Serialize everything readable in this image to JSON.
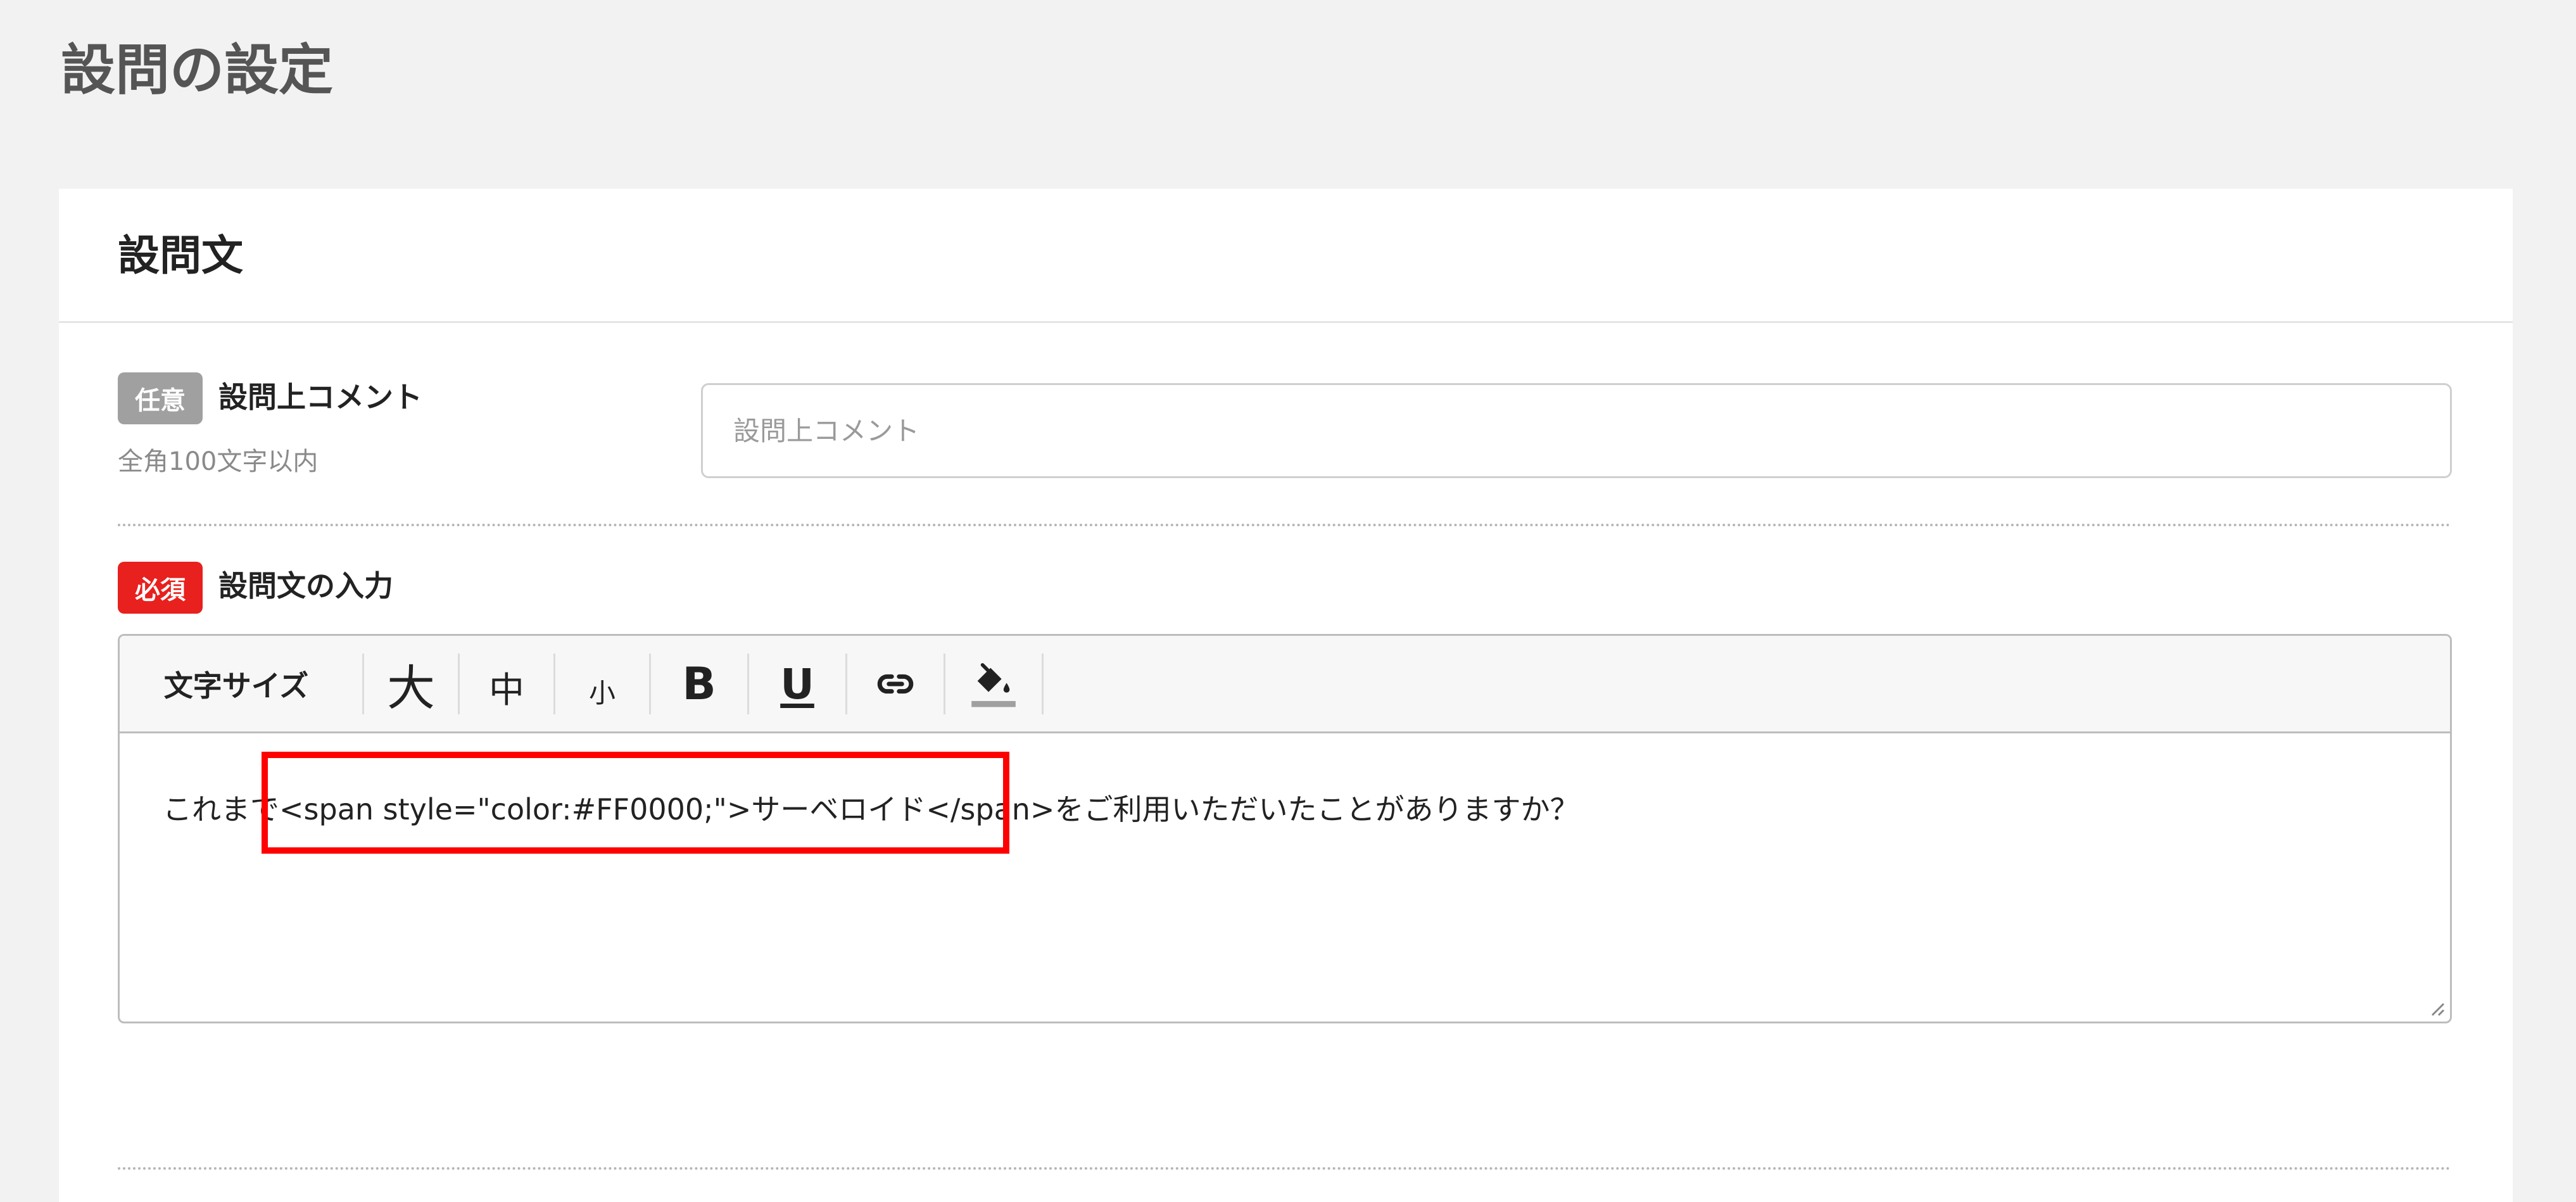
{
  "page": {
    "title": "設問の設定"
  },
  "section": {
    "title": "設問文"
  },
  "comment_field": {
    "badge": "任意",
    "label": "設問上コメント",
    "hint": "全角100文字以内",
    "placeholder": "設問上コメント",
    "value": ""
  },
  "question_field": {
    "badge": "必須",
    "label": "設問文の入力",
    "value": "これまで<span style=\"color:#FF0000;\">サーベロイド</span>をご利用いただいたことがありますか？"
  },
  "toolbar": {
    "font_size_label": "文字サイズ",
    "large_label": "大",
    "medium_label": "中",
    "small_label": "小",
    "bold_label": "B",
    "underline_label": "U",
    "link_icon": "link-icon",
    "fill_color_icon": "paint-bucket-icon"
  },
  "colors": {
    "page_background": "#f2f2f2",
    "card_background": "#ffffff",
    "optional_badge": "#a0a0a0",
    "required_badge": "#e8201e",
    "highlight_border": "#ff0000",
    "fill_color_underline": "#a0a0a0"
  }
}
